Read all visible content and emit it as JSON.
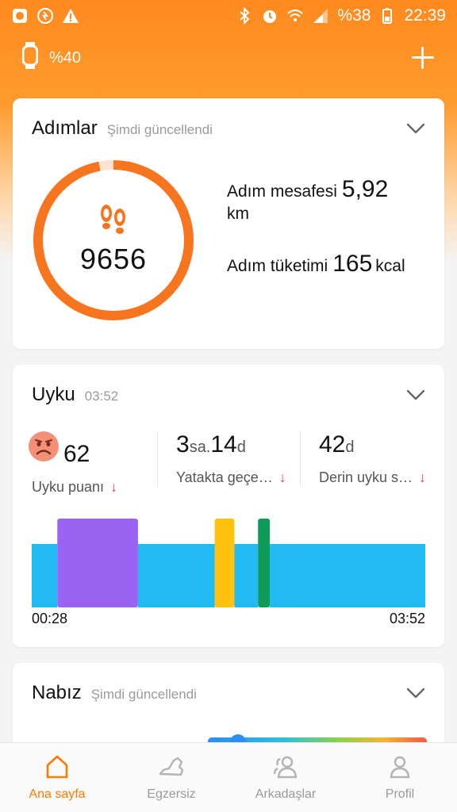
{
  "status_bar": {
    "battery_text": "%38",
    "time": "22:39"
  },
  "header": {
    "band_battery": "%40"
  },
  "steps": {
    "title": "Adımlar",
    "subtitle": "Şimdi güncellendi",
    "count": "9656",
    "goal_progress": 0.97,
    "distance_label": "Adım mesafesi",
    "distance_value": "5,92",
    "distance_unit": "km",
    "calories_label": "Adım tüketimi",
    "calories_value": "165",
    "calories_unit": "kcal"
  },
  "sleep": {
    "title": "Uyku",
    "time": "03:52",
    "score_value": "62",
    "score_label": "Uyku puanı",
    "bed_hours": "3",
    "bed_hours_unit": "sa.",
    "bed_minutes": "14",
    "bed_minutes_unit": "d",
    "bed_label": "Yatakta geçe…",
    "deep_value": "42",
    "deep_unit": "d",
    "deep_label": "Derin uyku s…",
    "chart_start": "00:28",
    "chart_end": "03:52",
    "segments": [
      {
        "stage": "light",
        "start": 0.0,
        "end": 0.065
      },
      {
        "stage": "rem",
        "start": 0.065,
        "end": 0.27
      },
      {
        "stage": "light",
        "start": 0.27,
        "end": 0.465
      },
      {
        "stage": "awake",
        "start": 0.465,
        "end": 0.515
      },
      {
        "stage": "light",
        "start": 0.515,
        "end": 0.575
      },
      {
        "stage": "deep",
        "start": 0.575,
        "end": 0.605
      },
      {
        "stage": "light",
        "start": 0.605,
        "end": 1.0
      }
    ],
    "colors": {
      "light": "#22baf2",
      "rem": "#9b63f2",
      "awake": "#ffc20e",
      "deep": "#0f9a5a"
    }
  },
  "heart": {
    "title": "Nabız",
    "subtitle": "Şimdi güncellendi"
  },
  "nav": {
    "home": "Ana sayfa",
    "workout": "Egzersiz",
    "friends": "Arkadaşlar",
    "profile": "Profil"
  },
  "colors": {
    "accent": "#ff7a00",
    "ring": "#f7751f"
  }
}
